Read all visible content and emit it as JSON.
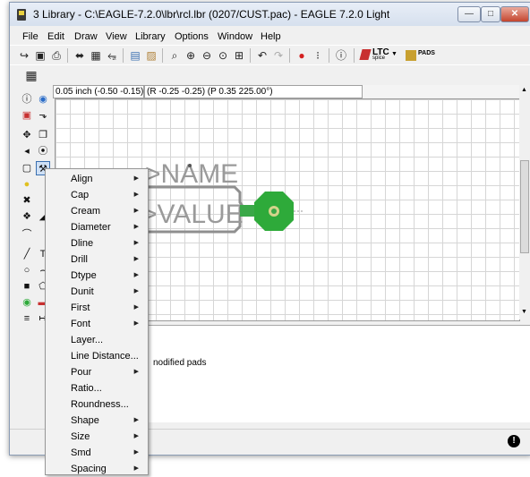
{
  "window": {
    "title": "3 Library - C:\\EAGLE-7.2.0\\lbr\\rcl.lbr (0207/CUST.pac) - EAGLE 7.2.0 Light",
    "minimize": "—",
    "maximize": "□",
    "close": "✕"
  },
  "menubar": [
    "File",
    "Edit",
    "Draw",
    "View",
    "Library",
    "Options",
    "Window",
    "Help"
  ],
  "toolbar": {
    "ltc_label": "LTC",
    "ltc_sub": "spice",
    "pads_label": "PADS"
  },
  "coords": {
    "grid": "0.05 inch (-0.50 -0.15)",
    "polar": "(R -0.25 -0.25) (P 0.35 225.00°)"
  },
  "canvas": {
    "name_text": ">NAME",
    "value_text": ">VALUE",
    "pad_color": "#2eaa3a",
    "text_color": "#9a9a9a"
  },
  "command_area": {
    "message": "nodified pads"
  },
  "context_menu": {
    "items": [
      {
        "label": "Align",
        "sub": "▶"
      },
      {
        "label": "Cap",
        "sub": "▶"
      },
      {
        "label": "Cream",
        "sub": "▶"
      },
      {
        "label": "Diameter",
        "sub": "▶"
      },
      {
        "label": "Dline",
        "sub": "▶"
      },
      {
        "label": "Drill",
        "sub": "▶"
      },
      {
        "label": "Dtype",
        "sub": "▶"
      },
      {
        "label": "Dunit",
        "sub": "▶"
      },
      {
        "label": "First",
        "sub": "▶"
      },
      {
        "label": "Font",
        "sub": "▶"
      },
      {
        "label": "Layer...",
        "sub": ""
      },
      {
        "label": "Line Distance...",
        "sub": ""
      },
      {
        "label": "Pour",
        "sub": "▶"
      },
      {
        "label": "Ratio...",
        "sub": ""
      },
      {
        "label": "Roundness...",
        "sub": ""
      },
      {
        "label": "Shape",
        "sub": "▶"
      },
      {
        "label": "Size",
        "sub": "▶"
      },
      {
        "label": "Smd",
        "sub": "▶"
      },
      {
        "label": "Spacing",
        "sub": "▶"
      }
    ]
  }
}
